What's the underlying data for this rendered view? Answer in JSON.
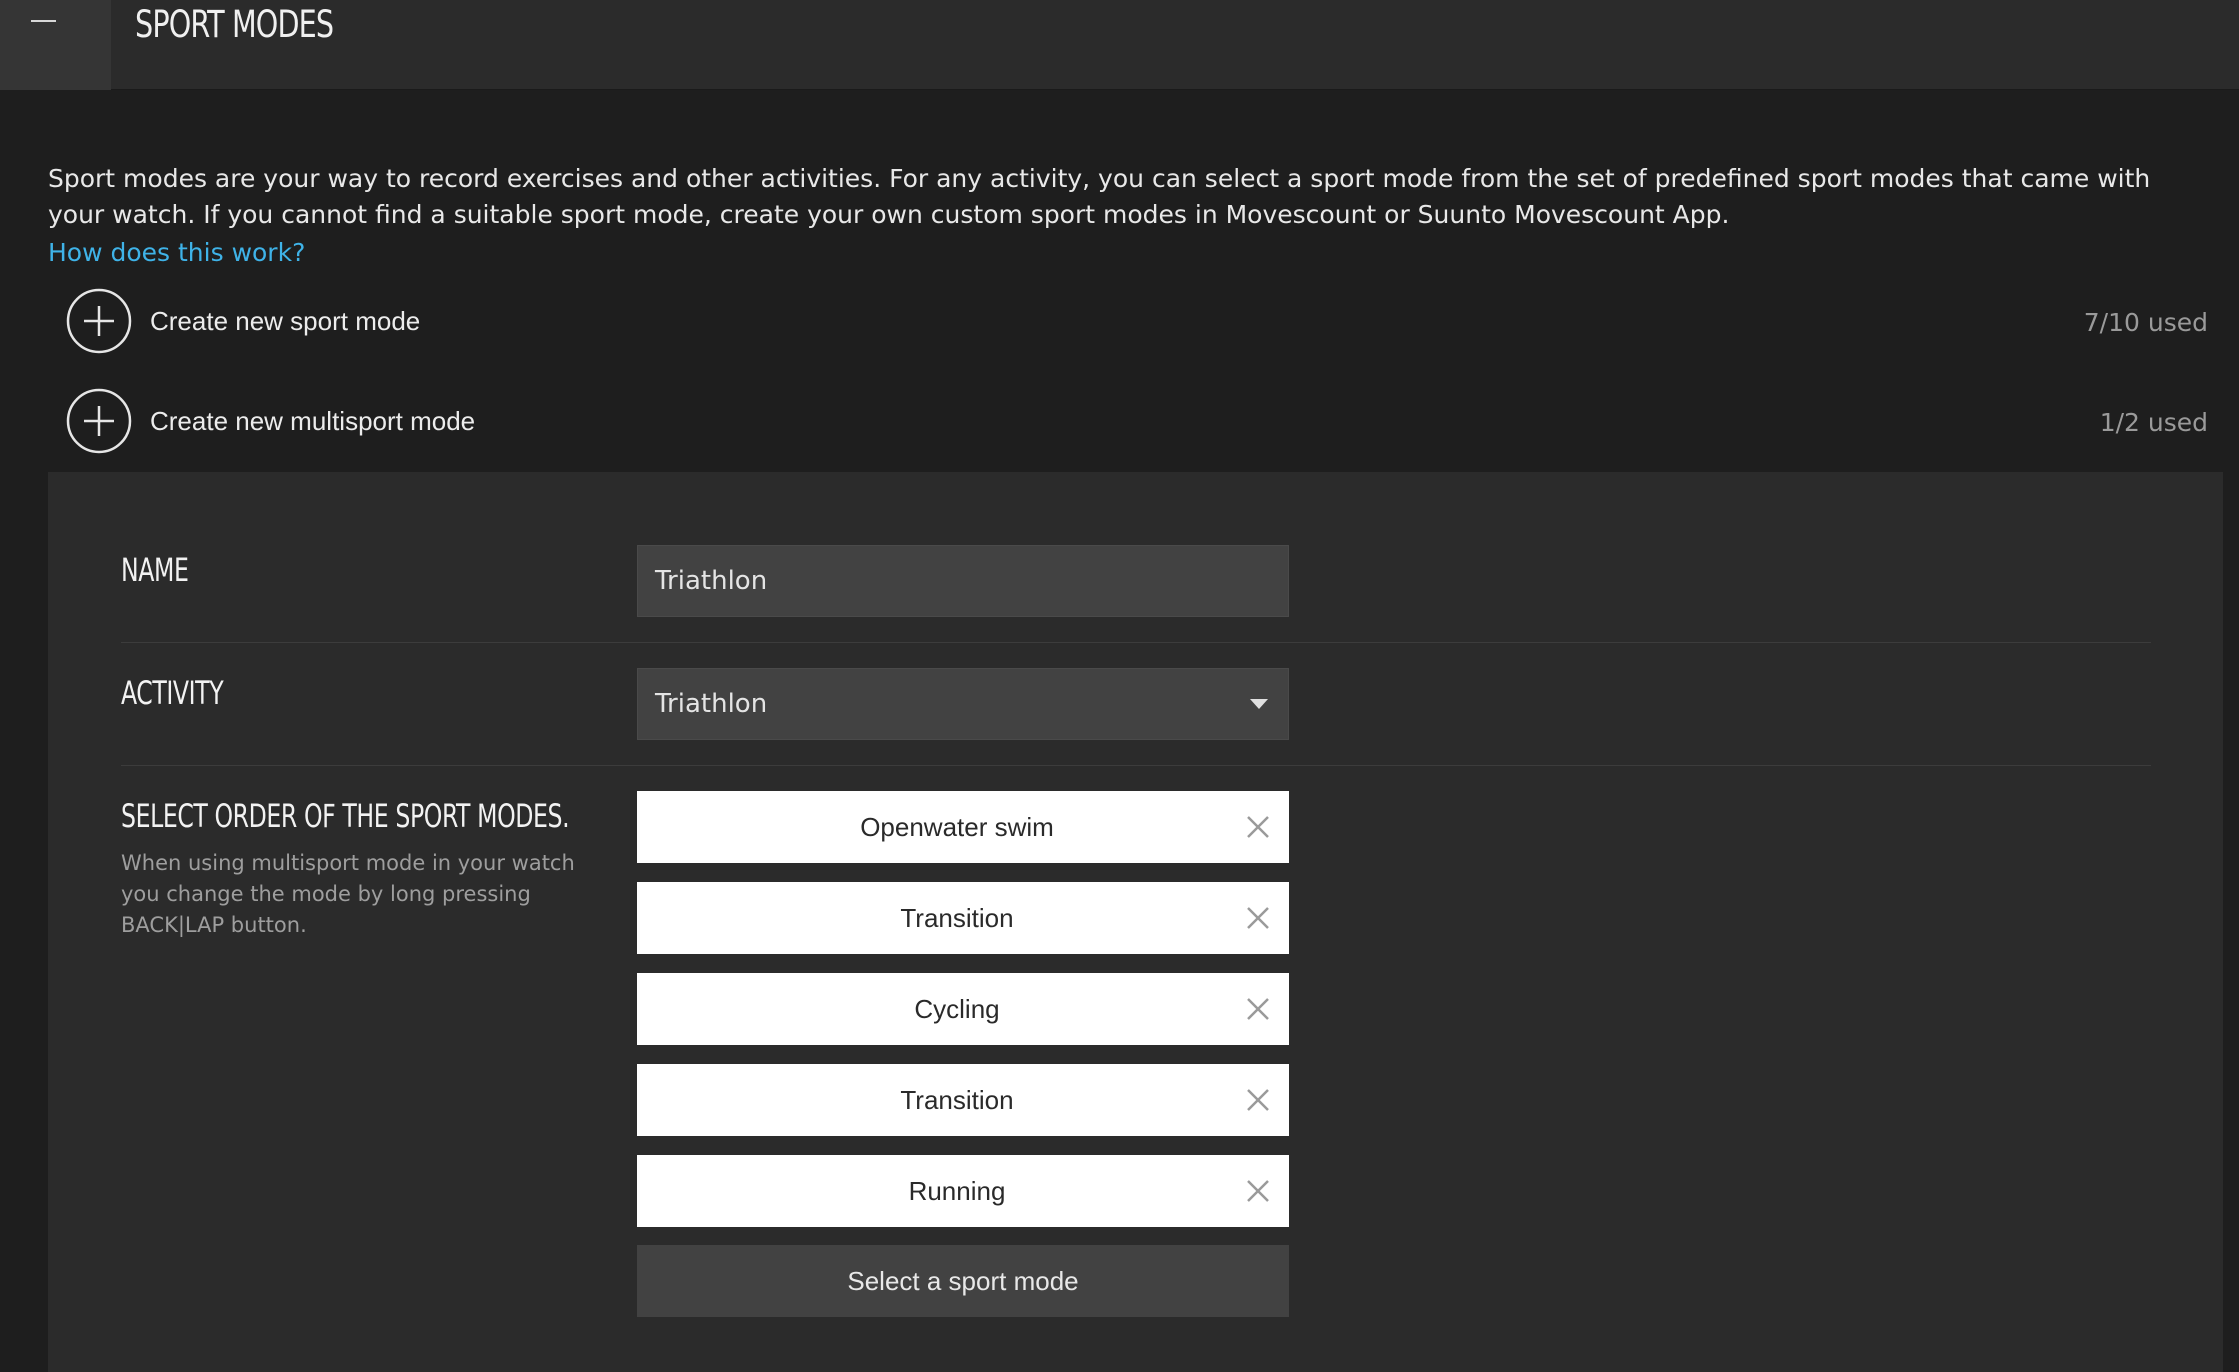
{
  "header": {
    "title": "SPORT MODES"
  },
  "intro": {
    "text": "Sport modes are your way to record exercises and other activities. For any activity, you can select a sport mode from the set of predefined sport modes that came with your watch. If you cannot find a suitable sport mode, create your own custom sport modes in Movescount or Suunto Movescount App.",
    "help_link": "How does this work?"
  },
  "create_sport_mode": {
    "label": "Create new sport mode",
    "used": "7/10 used"
  },
  "create_multisport_mode": {
    "label": "Create new multisport mode",
    "used": "1/2 used"
  },
  "form": {
    "name_label": "NAME",
    "name_value": "Triathlon",
    "activity_label": "ACTIVITY",
    "activity_value": "Triathlon",
    "order_label": "SELECT ORDER OF THE SPORT MODES.",
    "order_help": "When using multisport mode in your watch you change the mode by long pressing BACK|LAP button.",
    "modes": [
      "Openwater swim",
      "Transition",
      "Cycling",
      "Transition",
      "Running"
    ],
    "add_mode_label": "Select a sport mode"
  },
  "icons": {
    "collapse": "minus-icon",
    "create": "plus-circle-icon",
    "dropdown": "caret-down-icon",
    "remove": "close-icon"
  },
  "colors": {
    "background": "#1e1e1e",
    "header": "#2b2b2b",
    "panel": "#2b2b2b",
    "link": "#3fb3e8",
    "input": "#424242",
    "mode_item": "#ffffff"
  }
}
